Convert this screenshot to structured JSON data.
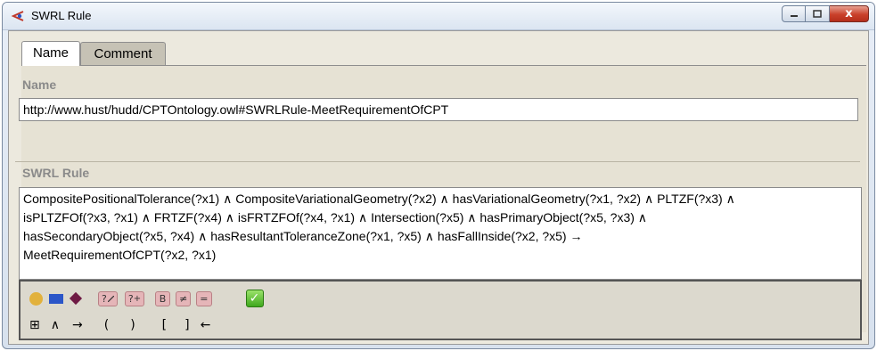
{
  "window": {
    "title": "SWRL Rule",
    "close_glyph": "x"
  },
  "tabs": [
    {
      "label": "Name",
      "active": true
    },
    {
      "label": "Comment",
      "active": false
    }
  ],
  "name_section": {
    "label": "Name",
    "value": "http://www.hust/hudd/CPTOntology.owl#SWRLRule-MeetRequirementOfCPT"
  },
  "rule_section": {
    "label": "SWRL Rule",
    "lines": [
      "CompositePositionalTolerance(?x1) ∧ CompositeVariationalGeometry(?x2) ∧ hasVariationalGeometry(?x1, ?x2) ∧ PLTZF(?x3) ∧",
      "isPLTZFOf(?x3, ?x1) ∧ FRTZF(?x4) ∧ isFRTZFOf(?x4, ?x1) ∧ Intersection(?x5) ∧ hasPrimaryObject(?x5, ?x3) ∧",
      "hasSecondaryObject(?x5, ?x4) ∧ hasResultantToleranceZone(?x1, ?x5) ∧ hasFallInside(?x2, ?x5) →",
      "MeetRequirementOfCPT(?x2, ?x1)"
    ]
  },
  "toolbar": {
    "row1": {
      "class_icon": "circle-icon",
      "property_icon": "rectangle-icon",
      "individual_icon": "diamond-icon",
      "question_label": "?",
      "question_add_label": "?",
      "builtin_label": "B",
      "not_equal_label": "≠",
      "equal_label": "=",
      "check_label": "✓"
    },
    "row2": {
      "grid_label": "⊞",
      "and_label": "∧",
      "implies_label": "→",
      "lparen_label": "(",
      "rparen_label": ")",
      "lbracket_label": "[",
      "rbracket_label": "]",
      "backspace_label": "←"
    }
  },
  "colors": {
    "panel_bg": "#ece9de",
    "inactive_tab": "#c6c2b5",
    "circle": "#e2b13c",
    "rect": "#2b56c8",
    "diamond": "#6e1a44",
    "pink_button": "#e5b5b8",
    "check_green": "#3fa81d"
  }
}
